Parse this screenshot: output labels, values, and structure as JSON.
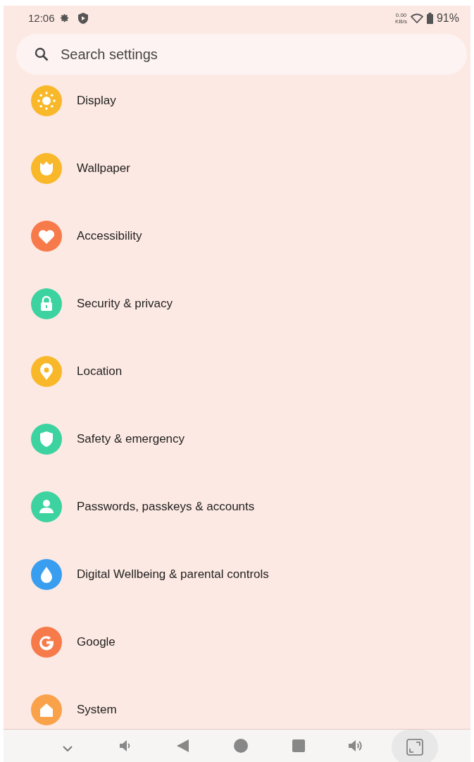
{
  "status_bar": {
    "time": "12:06",
    "speed_value": "0.00",
    "speed_unit": "KB/s",
    "battery": "91%"
  },
  "search": {
    "placeholder": "Search settings"
  },
  "items": [
    {
      "label": "Display",
      "kind": "sun",
      "color": "#f9b82a"
    },
    {
      "label": "Wallpaper",
      "kind": "tulip",
      "color": "#f9b82a"
    },
    {
      "label": "Accessibility",
      "kind": "heart",
      "color": "#f77a4a"
    },
    {
      "label": "Security & privacy",
      "kind": "lock",
      "color": "#3dd3a0"
    },
    {
      "label": "Location",
      "kind": "pin",
      "color": "#f9b82a"
    },
    {
      "label": "Safety & emergency",
      "kind": "shield",
      "color": "#3dd3a0"
    },
    {
      "label": "Passwords, passkeys & accounts",
      "kind": "person",
      "color": "#3dd3a0"
    },
    {
      "label": "Digital Wellbeing & parental controls",
      "kind": "drop",
      "color": "#3a9ef0"
    },
    {
      "label": "Google",
      "kind": "g",
      "color": "#f77a4a"
    },
    {
      "label": "System",
      "kind": "house",
      "color": "#f9a24a"
    }
  ]
}
